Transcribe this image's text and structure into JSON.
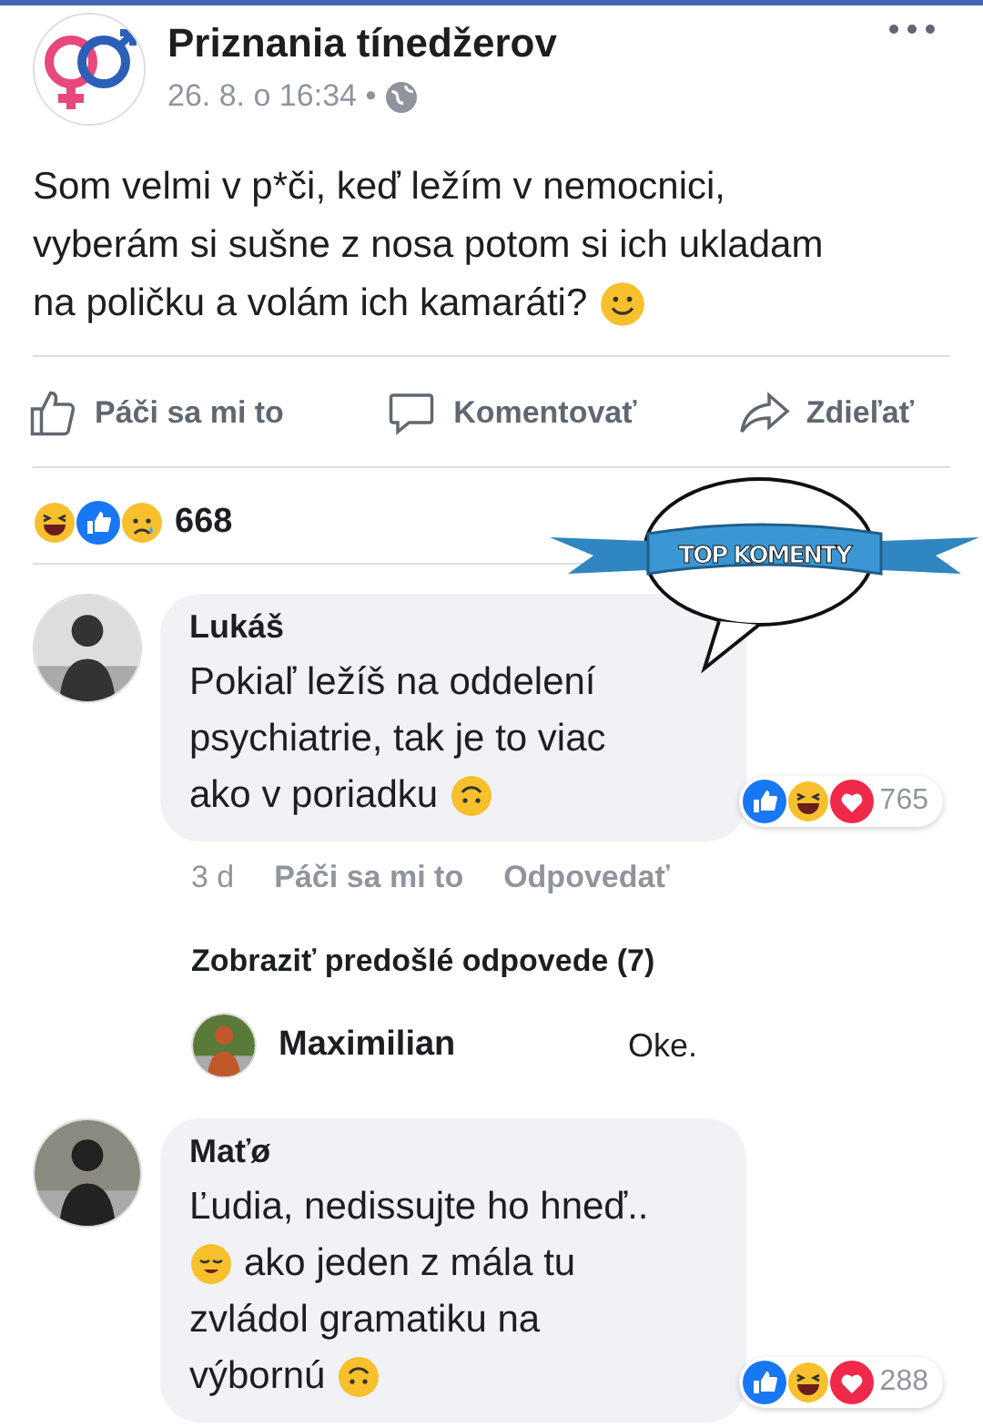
{
  "post": {
    "author": "Priznania tínedžerov",
    "time": "26. 8. o 16:34 •",
    "lines": [
      "Som velmi v p*či, keď ležím v nemocnici,",
      "vyberám si sušne z nosa potom si ich ukladam",
      "na poličku a volám ich kamaráti?"
    ]
  },
  "actions": [
    {
      "kind": "like",
      "label": "Páči sa mi to"
    },
    {
      "kind": "comment",
      "label": "Komentovať"
    },
    {
      "kind": "share",
      "label": "Zdieľať"
    }
  ],
  "reactions": {
    "count": "668"
  },
  "banner": {
    "label": "TOP KOMENTY"
  },
  "comments": [
    {
      "author": "Lukáš",
      "lines": [
        "Pokiaľ ležíš na oddelení",
        "psychiatrie, tak je to viac",
        "ako v poriadku"
      ],
      "reaction_count": "765",
      "meta": [
        "3 d",
        "Páči sa mi to",
        "Odpovedať"
      ],
      "more_replies": "Zobraziť predošlé odpovede (7)",
      "reply": {
        "author": "Maximilian",
        "text": "Oke."
      }
    },
    {
      "author": "Maťø",
      "lines": [
        "Ľudia, nedissujte ho hneď..",
        "ako jeden z mála tu",
        "zvládol gramatiku na",
        "výbornú"
      ],
      "reaction_count": "288"
    }
  ]
}
